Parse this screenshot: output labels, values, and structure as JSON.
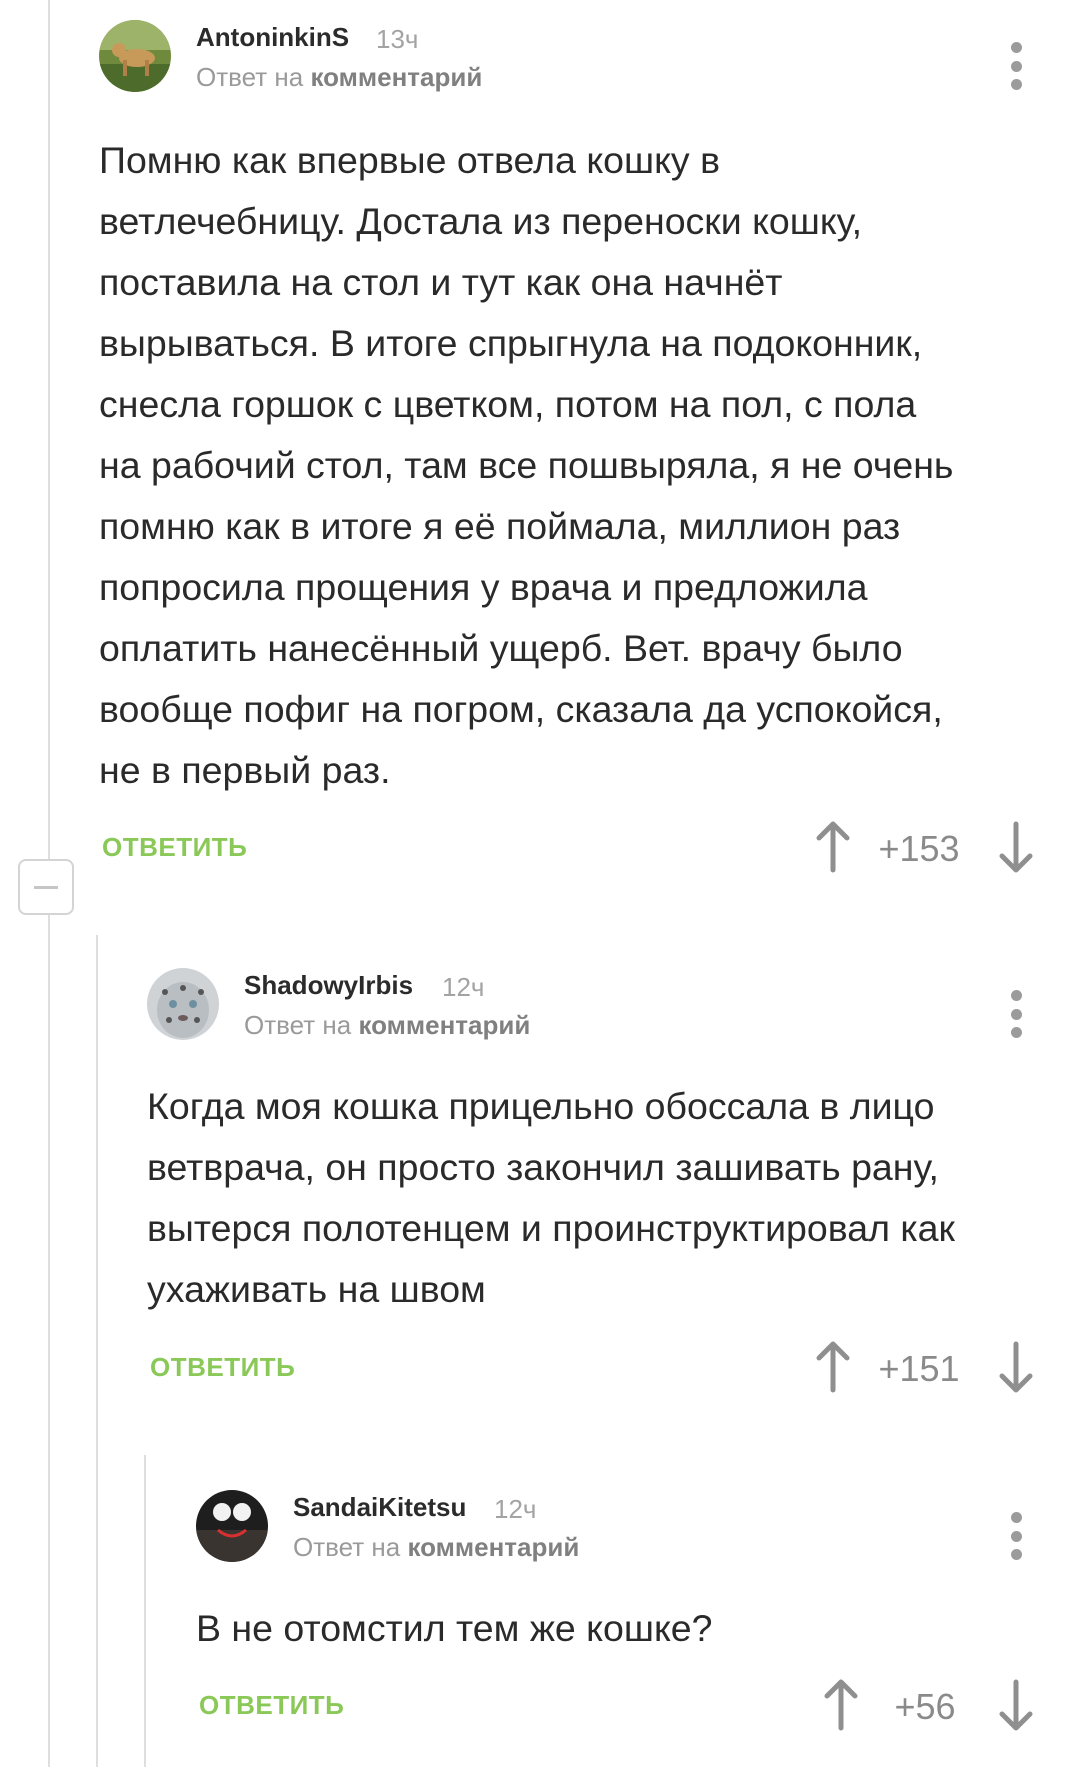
{
  "comments": [
    {
      "author": "AntoninkinS",
      "time": "13ч",
      "reply_prefix": "Ответ на",
      "reply_target": "комментарий",
      "text": "Помню как впервые отвела кошку в\nветлечебницу. Достала из переноски кошку,\nпоставила на стол и тут как она начнёт\nвырываться. В итоге спрыгнула на подоконник,\nснесла горшок с цветком, потом на пол, с пола\nна рабочий стол, там все пошвыряла, я не очень\nпомню как в итоге я её поймала, миллион раз\nпопросила прощения у врача и предложила\nоплатить нанесённый ущерб. Вет. врачу было\nвообще пофиг на погром, сказала да успокойся,\nне в первый раз.",
      "reply_label": "ОТВЕТИТЬ",
      "score": "+153"
    },
    {
      "author": "ShadowyIrbis",
      "time": "12ч",
      "reply_prefix": "Ответ на",
      "reply_target": "комментарий",
      "text": "Когда моя кошка прицельно обоссала в лицо\nветврача, он просто закончил зашивать рану,\nвытерся полотенцем и проинструктировал как\nухаживать на швом",
      "reply_label": "ОТВЕТИТЬ",
      "score": "+151"
    },
    {
      "author": "SandaiKitetsu",
      "time": "12ч",
      "reply_prefix": "Ответ на",
      "reply_target": "комментарий",
      "text": "В не отомстил тем же кошке?",
      "reply_label": "ОТВЕТИТЬ",
      "score": "+56"
    }
  ],
  "icons": {
    "vote_up": "arrow-up-icon",
    "vote_down": "arrow-down-icon",
    "more": "more-vertical-icon",
    "collapse": "minus-icon"
  },
  "colors": {
    "reply_green": "#8ac858",
    "meta_gray": "#9a9a9a",
    "thread_line": "#dedede"
  }
}
